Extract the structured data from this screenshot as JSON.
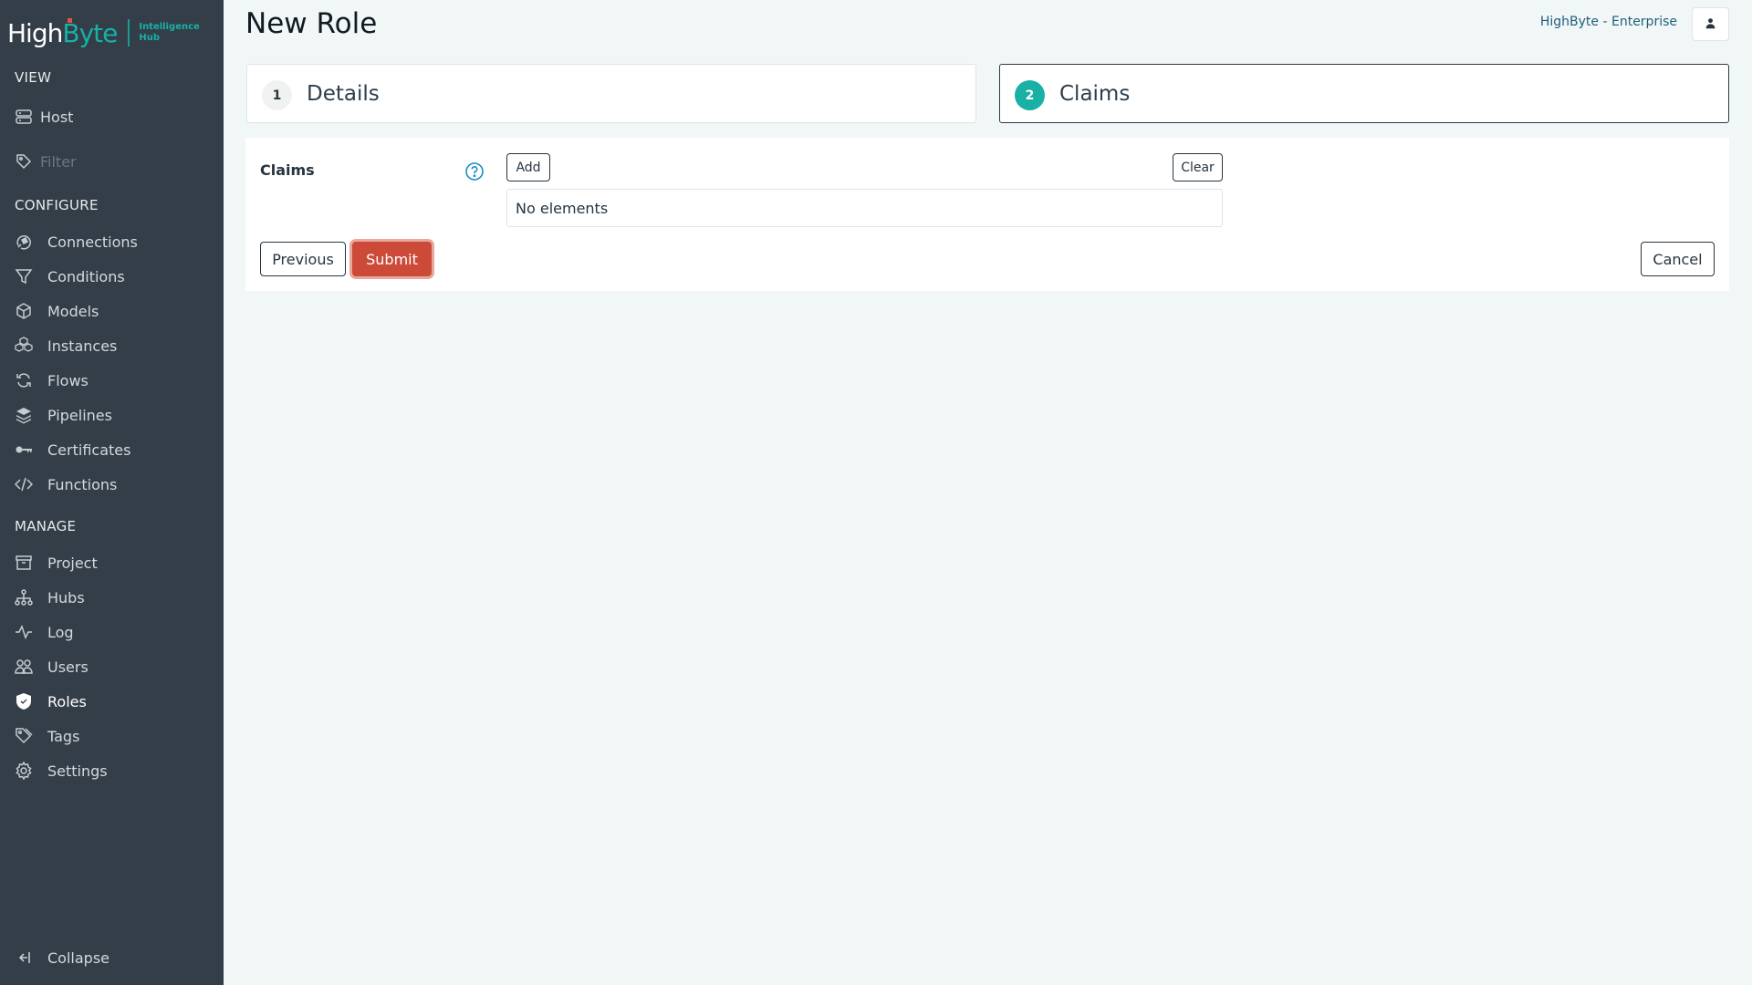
{
  "app": {
    "logo_primary": "High",
    "logo_secondary": "Byte",
    "logo_sub_line1": "Intelligence",
    "logo_sub_line2": "Hub",
    "brand_color": "#19b0a6"
  },
  "sidebar": {
    "view_header": "VIEW",
    "host_label": "Host",
    "filter_placeholder": "Filter",
    "configure_header": "CONFIGURE",
    "configure_items": [
      {
        "label": "Connections",
        "icon": "plug-icon"
      },
      {
        "label": "Conditions",
        "icon": "filter-icon"
      },
      {
        "label": "Models",
        "icon": "cube-icon"
      },
      {
        "label": "Instances",
        "icon": "cubes-icon"
      },
      {
        "label": "Flows",
        "icon": "sync-icon"
      },
      {
        "label": "Pipelines",
        "icon": "layers-icon"
      },
      {
        "label": "Certificates",
        "icon": "key-icon"
      },
      {
        "label": "Functions",
        "icon": "code-icon"
      }
    ],
    "manage_header": "MANAGE",
    "manage_items": [
      {
        "label": "Project",
        "icon": "archive-icon"
      },
      {
        "label": "Hubs",
        "icon": "sitemap-icon"
      },
      {
        "label": "Log",
        "icon": "activity-icon"
      },
      {
        "label": "Users",
        "icon": "users-icon"
      },
      {
        "label": "Roles",
        "icon": "shield-check-icon",
        "active": true
      },
      {
        "label": "Tags",
        "icon": "tags-icon"
      },
      {
        "label": "Settings",
        "icon": "gear-icon"
      }
    ],
    "collapse_label": "Collapse"
  },
  "header": {
    "title": "New Role",
    "brand_link": "HighByte - Enterprise"
  },
  "steps": [
    {
      "number": "1",
      "label": "Details",
      "active": false
    },
    {
      "number": "2",
      "label": "Claims",
      "active": true
    }
  ],
  "form": {
    "claims_label": "Claims",
    "add_label": "Add",
    "clear_label": "Clear",
    "empty_text": "No elements",
    "previous_label": "Previous",
    "submit_label": "Submit",
    "cancel_label": "Cancel",
    "submit_color": "#cc4a38",
    "help_color": "#1a8fc4"
  }
}
